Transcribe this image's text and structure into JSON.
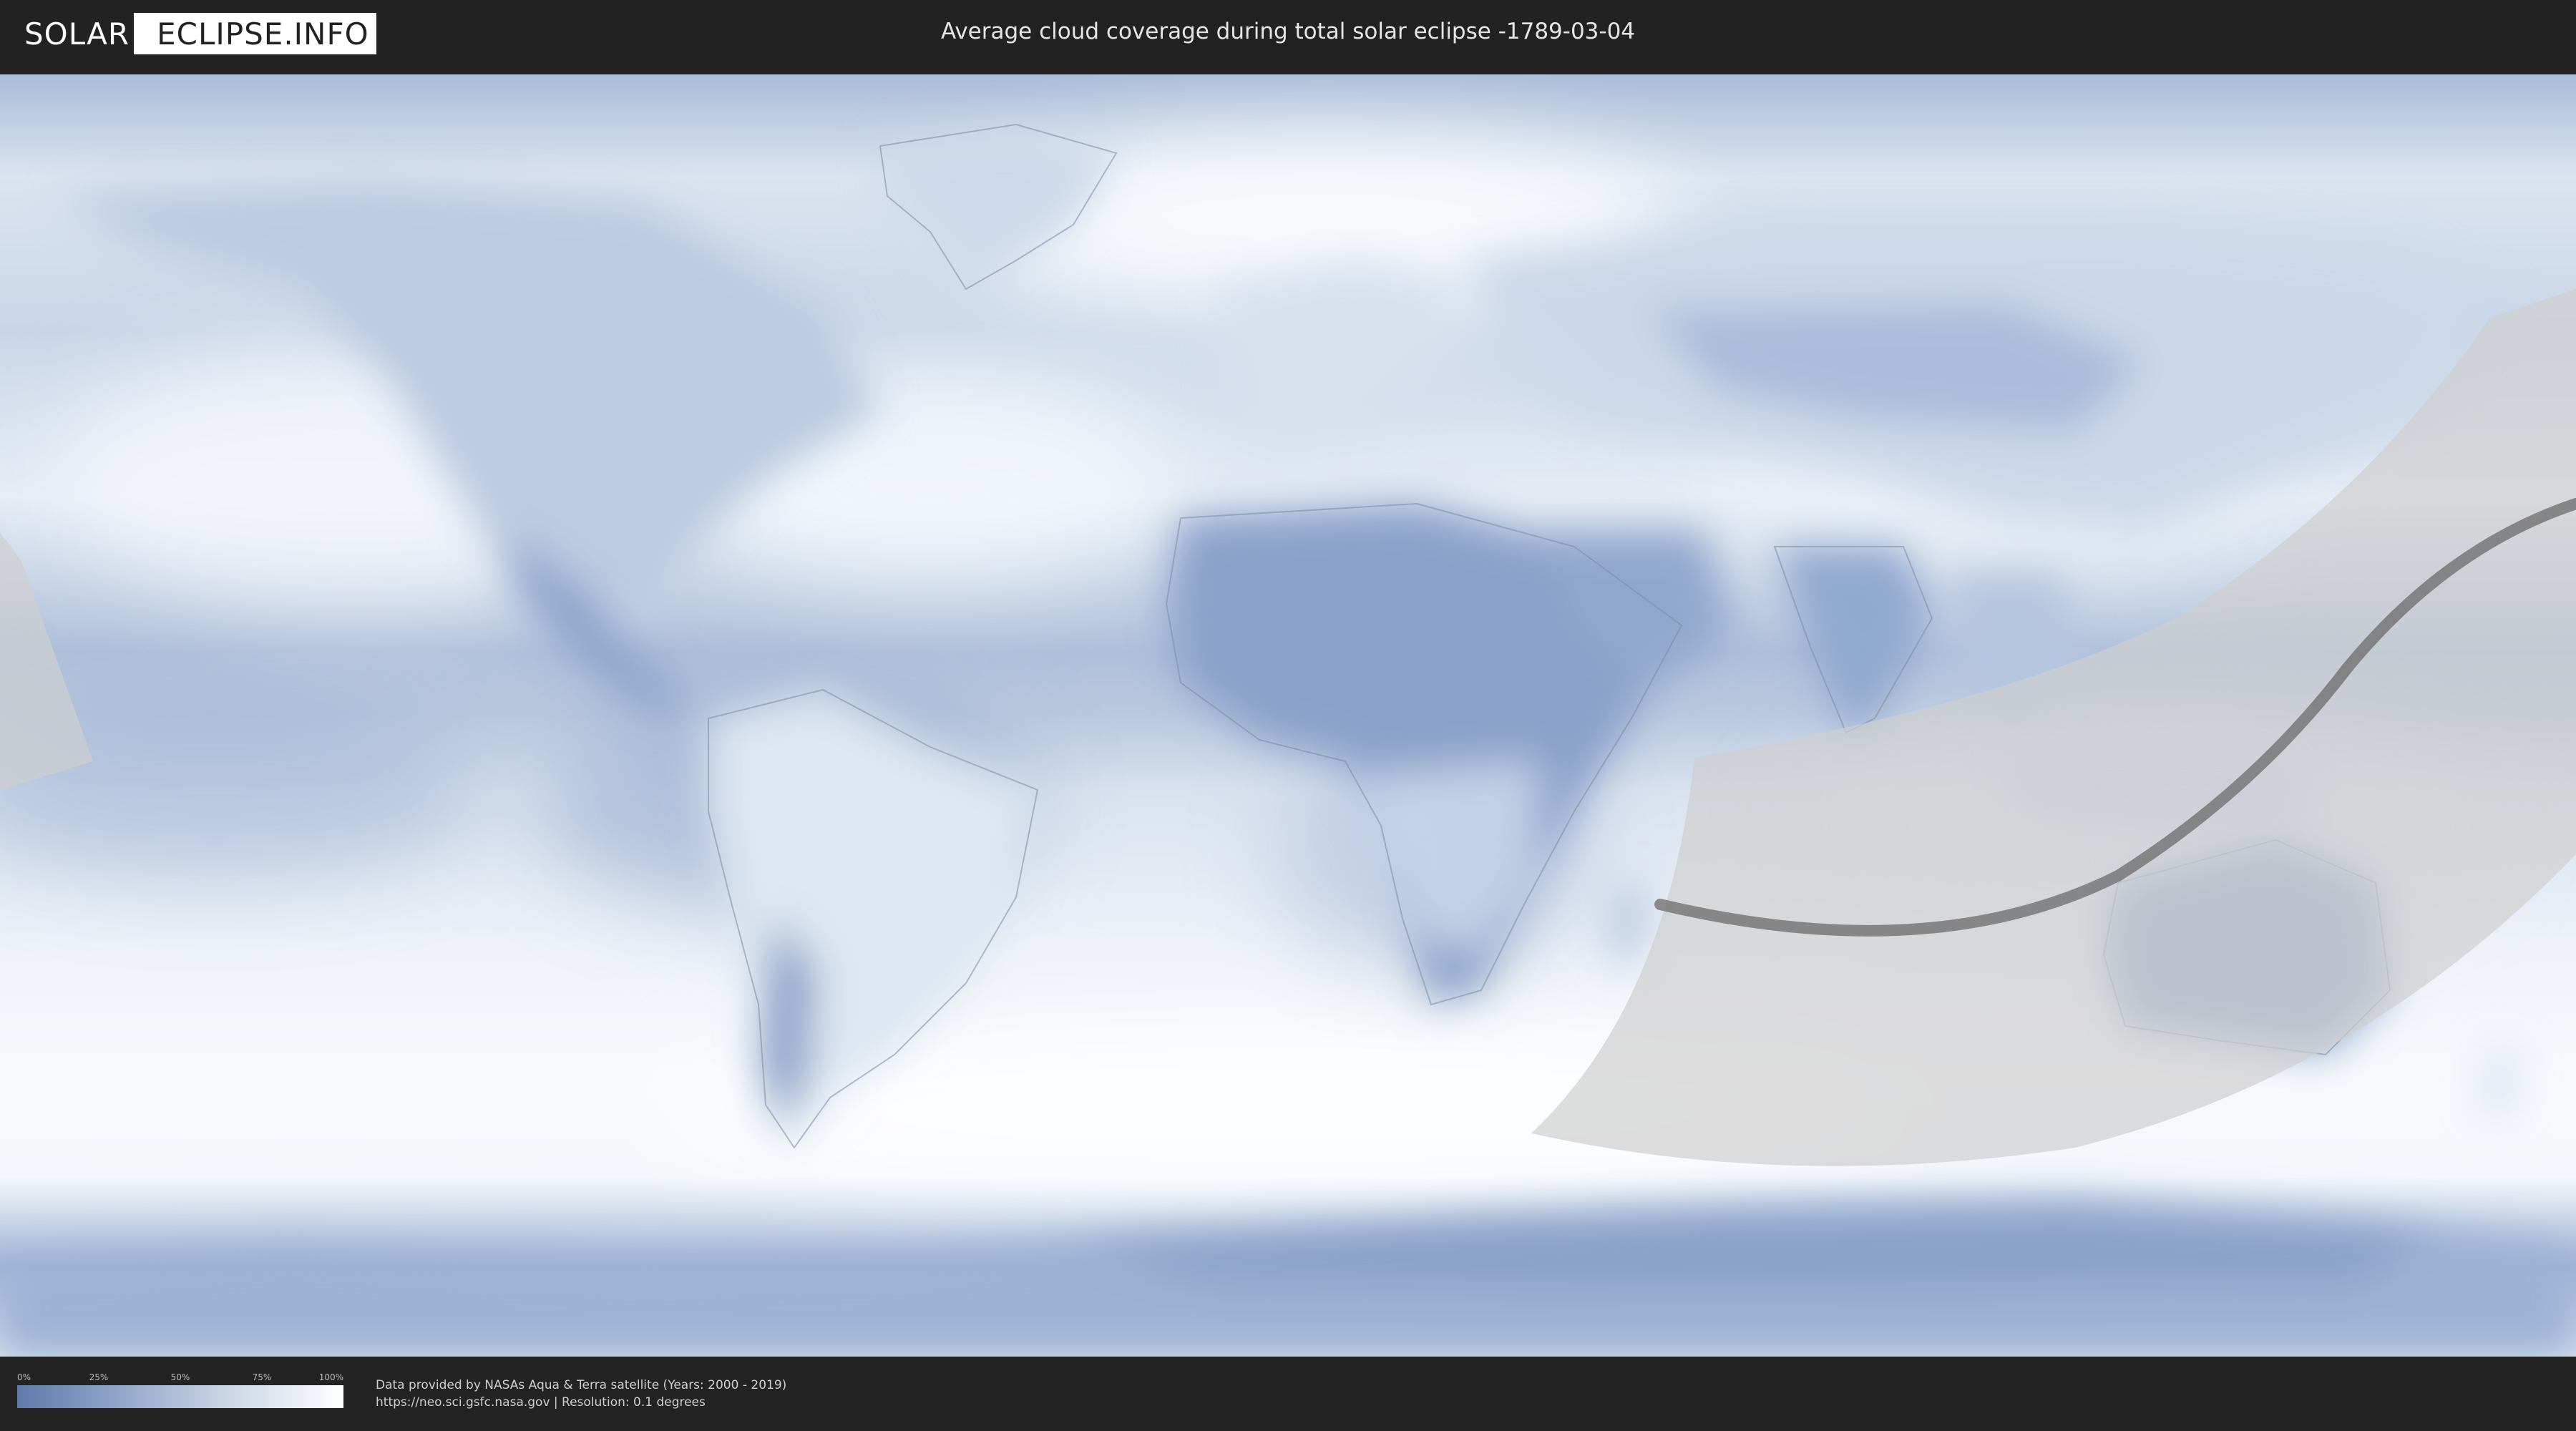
{
  "header": {
    "logo_left": "SOLAR",
    "logo_right": "ECLIPSE.INFO",
    "title": "Average cloud coverage during total solar eclipse -1789-03-04"
  },
  "map": {
    "kind": "world-cloud-coverage",
    "projection": "equirectangular",
    "eclipse_path_shown": true,
    "colors": {
      "ocean_cloud_low": "#6f8ebe",
      "cloud_high": "#ffffff",
      "visibility_zone": "#cfcfcf",
      "central_path": "#6b6b6b",
      "border_lines": "#8a96a8"
    }
  },
  "legend": {
    "ticks": [
      "0%",
      "25%",
      "50%",
      "75%",
      "100%"
    ],
    "gradient": [
      "#5f7bab",
      "#ffffff"
    ]
  },
  "footer": {
    "credit_line1": "Data provided by NASAs Aqua & Terra satellite (Years: 2000 - 2019)",
    "credit_line2": "https://neo.sci.gsfc.nasa.gov | Resolution: 0.1 degrees"
  }
}
